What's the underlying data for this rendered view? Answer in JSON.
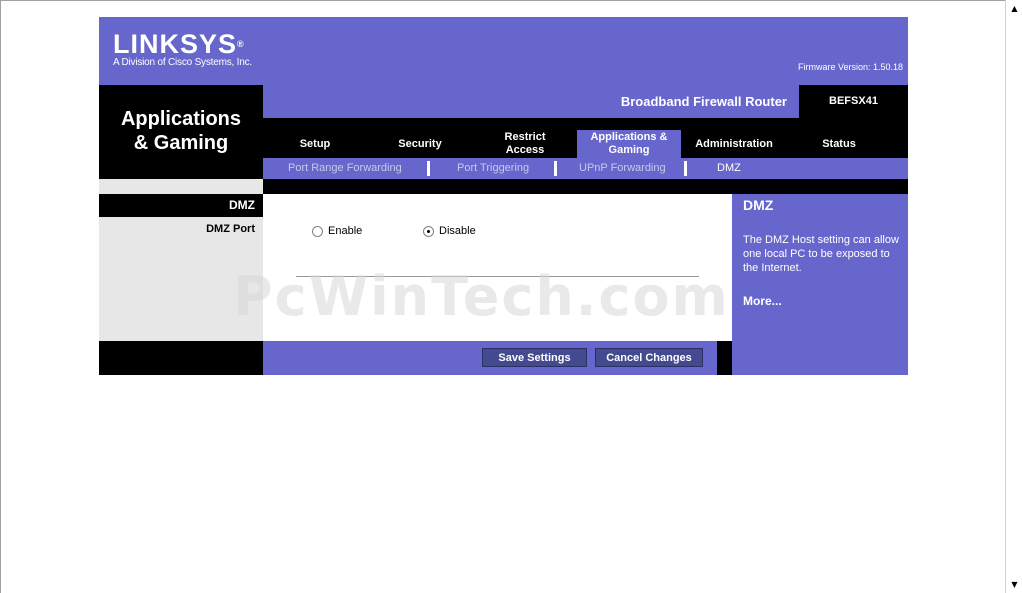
{
  "brand": {
    "logo_text": "LINKSYS",
    "logo_mark": "®",
    "subtitle": "A Division of Cisco Systems, Inc.",
    "firmware": "Firmware Version: 1.50.18"
  },
  "page_title_line1": "Applications",
  "page_title_line2": "& Gaming",
  "product": {
    "name": "Broadband Firewall Router",
    "model": "BEFSX41"
  },
  "tabs": [
    {
      "label": "Setup",
      "active": false
    },
    {
      "label": "Security",
      "active": false
    },
    {
      "label": "Restrict Access",
      "active": false
    },
    {
      "label": "Applications & Gaming",
      "active": true
    },
    {
      "label": "Administration",
      "active": false
    },
    {
      "label": "Status",
      "active": false
    }
  ],
  "subtabs": [
    {
      "label": "Port Range Forwarding",
      "active": false
    },
    {
      "label": "Port Triggering",
      "active": false
    },
    {
      "label": "UPnP Forwarding",
      "active": false
    },
    {
      "label": "DMZ",
      "active": true
    }
  ],
  "section": {
    "title": "DMZ",
    "field_label": "DMZ Port"
  },
  "dmz": {
    "enable_label": "Enable",
    "disable_label": "Disable",
    "selected": "Disable"
  },
  "help": {
    "title": "DMZ",
    "text": "The DMZ Host setting can allow one local PC to be exposed to the Internet.",
    "more": "More..."
  },
  "buttons": {
    "save": "Save Settings",
    "cancel": "Cancel Changes"
  },
  "watermark": "PcWinTech.com",
  "colors": {
    "accent": "#6666cc",
    "dark": "#000000",
    "panel": "#e7e7e7",
    "button": "#434a8f"
  }
}
